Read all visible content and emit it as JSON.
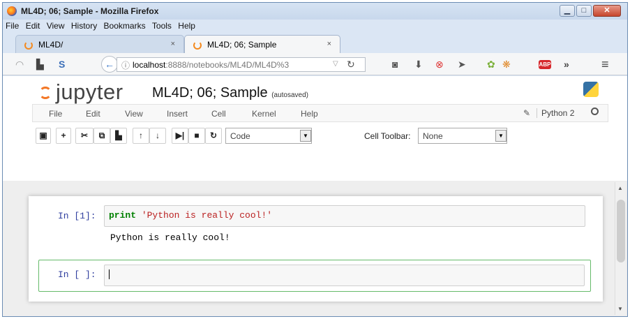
{
  "window": {
    "title": "ML4D; 06; Sample - Mozilla Firefox"
  },
  "menubar": [
    "File",
    "Edit",
    "View",
    "History",
    "Bookmarks",
    "Tools",
    "Help"
  ],
  "tabs": [
    {
      "label": "ML4D/",
      "active": false,
      "close": "×"
    },
    {
      "label": "ML4D; 06; Sample",
      "active": true,
      "close": "×"
    }
  ],
  "navbar": {
    "url_host": "localhost",
    "url_rest": ":8888/notebooks/ML4D/ML4D%3",
    "abp_label": "ABP",
    "overflow": "»",
    "menu": "≡"
  },
  "jupyter": {
    "logo_text": "jupyter",
    "notebook_name": "ML4D; 06; Sample",
    "autosave_status": "(autosaved)",
    "menu": [
      "File",
      "Edit",
      "View",
      "Insert",
      "Cell",
      "Kernel",
      "Help"
    ],
    "kernel_name": "Python 2",
    "toolbar": {
      "cell_type": "Code",
      "cell_toolbar_label": "Cell Toolbar:",
      "cell_toolbar_value": "None"
    },
    "cells": [
      {
        "prompt": "In [1]:",
        "code_keyword": "print",
        "code_string": "'Python is really cool!'",
        "output": "Python is really cool!"
      },
      {
        "prompt": "In [ ]:",
        "code": ""
      }
    ]
  }
}
